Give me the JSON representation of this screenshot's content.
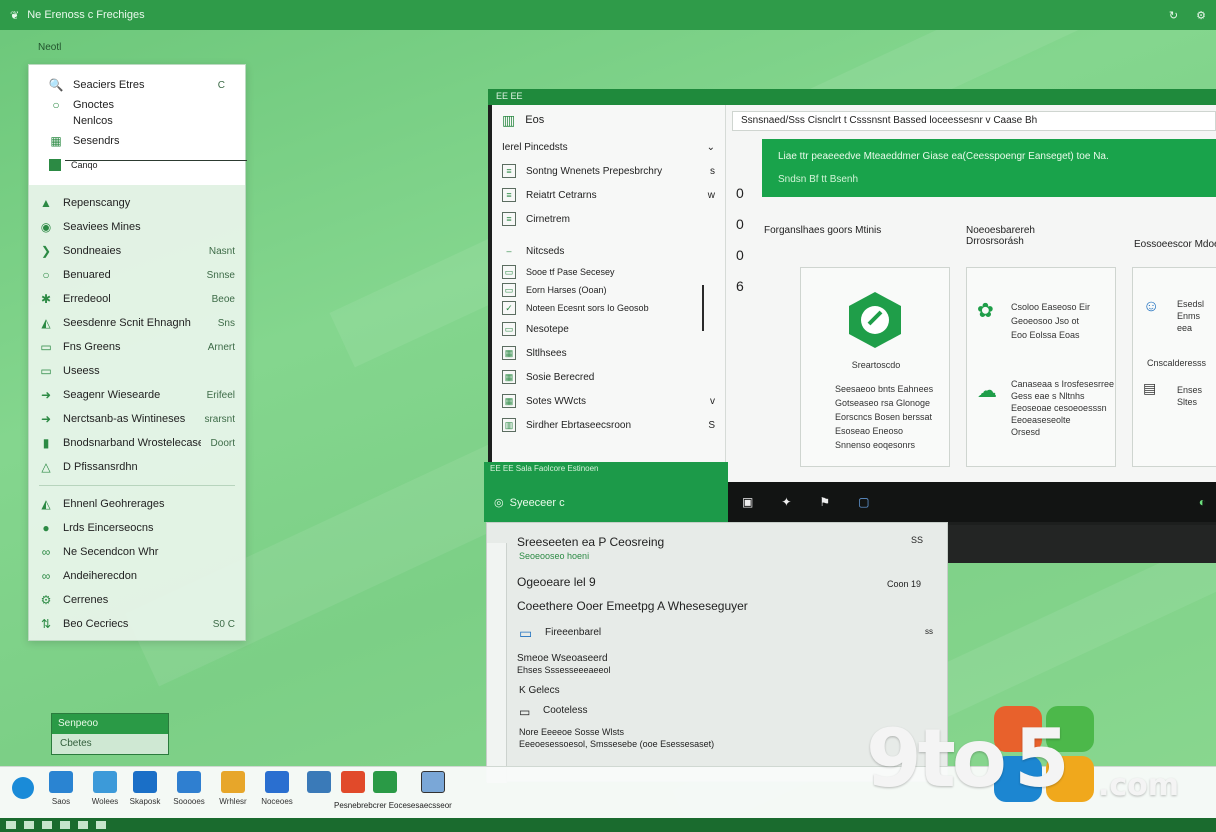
{
  "topbar": {
    "title": "Ne Erenoss c Frechiges",
    "icons": [
      "refresh-icon",
      "settings-icon"
    ]
  },
  "desktop_label": "Neotl",
  "start": {
    "head": [
      {
        "icon": "search-icon",
        "label": "Seaciers Etres",
        "val": "C"
      },
      {
        "icon": "circle-icon",
        "label": "Gnoctes",
        "val": ""
      },
      {
        "icon": "",
        "label": "Nenlcos",
        "val": ""
      },
      {
        "icon": "grid-icon",
        "label": "Sesendrs",
        "val": ""
      },
      {
        "icon": "square-icon",
        "label": "Canqo",
        "val": ""
      }
    ],
    "items": [
      {
        "icon": "mountain-icon",
        "label": "Repenscangy",
        "val": ""
      },
      {
        "icon": "globe-icon",
        "label": "Seaviees Mines",
        "val": ""
      },
      {
        "icon": "chevron-icon",
        "label": "Sondneaies",
        "val": "Nasnt"
      },
      {
        "icon": "magnify-icon",
        "label": "Benuared",
        "val": "Snnse"
      },
      {
        "icon": "leaf-icon",
        "label": "Erredeool",
        "val": "Beoe"
      },
      {
        "icon": "chart-icon",
        "label": "Seesdenre Scnit Ehnagnh",
        "val": "Sns"
      },
      {
        "icon": "window-icon",
        "label": "Fns Greens",
        "val": "Arnert"
      },
      {
        "icon": "window-icon",
        "label": "Useess",
        "val": ""
      },
      {
        "icon": "arrow-icon",
        "label": "Seagenr Wiesearde",
        "val": "Erifeel"
      },
      {
        "icon": "arrow-icon",
        "label": "Nerctsanb-as Wintineses",
        "val": "srarsnt"
      },
      {
        "icon": "user-icon",
        "label": "Bnodsnarband Wrostelecase",
        "val": "Doort"
      },
      {
        "icon": "mountain-icon",
        "label": "D Pfissansrdhn",
        "val": ""
      }
    ],
    "footer": [
      {
        "icon": "mountain-icon",
        "label": "Ehnenl Geohrerages",
        "val": ""
      },
      {
        "icon": "user-icon",
        "label": "Lrds Eincerseocns",
        "val": ""
      },
      {
        "icon": "link-icon",
        "label": "Ne Secendcon Whr",
        "val": ""
      },
      {
        "icon": "link-icon",
        "label": "Andeiherecdon",
        "val": ""
      },
      {
        "icon": "settings-icon",
        "label": "Cerrenes",
        "val": ""
      },
      {
        "icon": "sort-icon",
        "label": "Beo Cecriecs",
        "val": "S0 C"
      }
    ]
  },
  "tiny_card": {
    "title": "Senpeoo",
    "sub": "Cbetes"
  },
  "window": {
    "top": "EE  EE",
    "nav_title": "Eos",
    "nav_section": "Ierel Pincedsts",
    "nav_items": [
      "Sontng Wnenets Prepesbrchry",
      "Reiatrt Cetrarns",
      "Cirnetrem",
      "Nitcseds",
      "Sooe tf Pase Secesey",
      "Eorn Harses (Ooan)",
      "Noteen Ecesnt sors Io Geosob",
      "Nesotepe",
      "Sltlhsees",
      "Sosie Berecred",
      "Sotes WWcts",
      "Sirdher Ebrtaseecsroon",
      "Sale Eaolcore Estinoen"
    ],
    "nav_right_marks": [
      "s",
      "w",
      "",
      "",
      "",
      "",
      "",
      "",
      "",
      "",
      "v",
      "S"
    ],
    "addr": "Ssnsnaed/Sss Cisnclrt t Csssnsnt Bassed  loceessesnr v Caase Bh",
    "banner_line1": "Liae ttr peaeeedve Mteaeddmer Giase ea(Ceesspoengr Eanseget) toe Na.",
    "banner_line2": "Sndsn Bf tt Bsenh",
    "left_marks": [
      "0",
      "0",
      "0",
      "6"
    ],
    "sections": [
      "Forganslhaes goors Mtinis",
      "Noeoesbarereh\nDrrosrsorásh",
      "Eossoeescor Mdoe"
    ],
    "card1": {
      "title": "Sreartoscdo",
      "b1": "Seesaeoo bnts Eahnees",
      "b2": "Gotseaseo rsa Glonoge",
      "b3": "Eorscncs Bosen berssat",
      "b4": "Esoseao Eneoso",
      "b5": "Snnenso eoqesonrs"
    },
    "card2": {
      "l1": "Csoloo Easeoso Eir",
      "l2": "Geoeosoo Jso ot",
      "l3": "Eoo Eolssa Eoas",
      "l4": "Canaseaa s Irosfesesrree",
      "l5": "Gess eae s Nltnhs",
      "l6": "Eeoseoae cesoeoesssn",
      "l7": "Eeoeaseseolte",
      "l8": "Orsesd"
    },
    "card3": {
      "l1": "Esedsl",
      "l2": "Enms eea",
      "l3": "Cnscalderesss",
      "l4": "Enses",
      "l5": "Sltes"
    },
    "strip_icons": [
      "app-icon",
      "settings-icon",
      "flag-icon",
      "box-icon",
      "logo-icon"
    ]
  },
  "dialog": {
    "tab": "EE  EE  Sala Faolcore Estinoen",
    "title": "Syeeceer c",
    "h1": "Sreeseeten ea P Ceosreing",
    "h1_sub": "Seoeooseo hoeni",
    "h1_right": "SS",
    "h2": "Ogeoeare lel 9",
    "h2_right": "Coon   19",
    "h3": "Coeethere Ooer Emeetpg A Wheseseguyer",
    "item1": "Fireeenbarel",
    "item1_right": "ss",
    "item2": "Smeoe Wseoaseerd",
    "item2_sub": "Ehses Sssesseeeaeeol",
    "item3": "K Gelecs",
    "item4": "Cooteless",
    "item5": "Nore Eeeeoe Sosse Wlsts",
    "item5_sub": "Eeeoesessoesol, Smssesebe (ooe Esessesaset)"
  },
  "taskbar": {
    "items": [
      {
        "label": "",
        "color": "#1a8bd8"
      },
      {
        "label": "Saos",
        "color": "#2a84d2"
      },
      {
        "label": "Wolees",
        "color": "#3c9ad9"
      },
      {
        "label": "Skaposk",
        "color": "#1a6fc7"
      },
      {
        "label": "Sooooes",
        "color": "#2f7fd0"
      },
      {
        "label": "Wrhlesr",
        "color": "#e7a62a"
      },
      {
        "label": "Noceoes",
        "color": "#2a6fd0"
      },
      {
        "label": "",
        "color": "#3a7ab8"
      },
      {
        "label": "",
        "color": "#e14a2a"
      },
      {
        "label": "",
        "color": "#2a9a46"
      },
      {
        "label": "",
        "color": "#7aa7d7"
      }
    ],
    "wide_label": "Pesnebrebcrer Eocesesaecsseor"
  },
  "watermark": {
    "text_9to": "9to",
    "text_5": "5",
    "text_com": ".com"
  }
}
